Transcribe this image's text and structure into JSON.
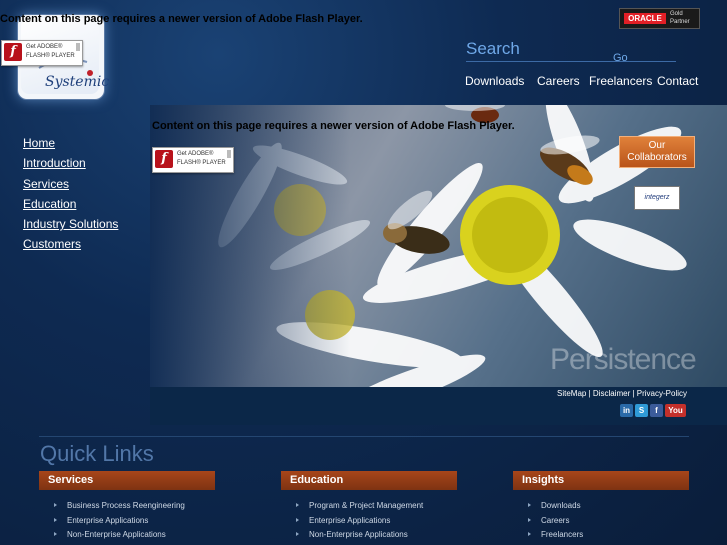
{
  "flash": {
    "message": "Content on this page requires a newer version of Adobe Flash Player.",
    "badge_line1": "Get ADOBE®",
    "badge_line2": "FLASH® PLAYER",
    "badge_icon": "f"
  },
  "logo": {
    "text": "Systemic"
  },
  "oracle": {
    "name": "ORACLE",
    "tier": "Gold",
    "partner": "Partner"
  },
  "search": {
    "label": "Search",
    "placeholder": "",
    "go": "Go"
  },
  "topnav": [
    "Downloads",
    "Careers",
    "Freelancers",
    "Contact"
  ],
  "leftnav": [
    "Home",
    "Introduction ",
    "Services",
    "Education",
    "Industry Solutions",
    "Customers"
  ],
  "hero": {
    "tagline": "Persistence",
    "collaborators_line1": "Our",
    "collaborators_line2": "Collaborators",
    "partner_logo": "integerz"
  },
  "footer": {
    "sitemap": "SiteMap",
    "sep": " | ",
    "disclaimer": "Disclaimer",
    "privacy": "Privacy-Policy"
  },
  "social": [
    {
      "icon": "linkedin-icon",
      "glyph": "in",
      "color": "#2a6aa8"
    },
    {
      "icon": "skype-icon",
      "glyph": "S",
      "color": "#2f9ad6"
    },
    {
      "icon": "facebook-icon",
      "glyph": "f",
      "color": "#3b5b9a"
    },
    {
      "icon": "youtube-icon",
      "glyph": "You",
      "color": "#c4302b"
    }
  ],
  "quick_links": {
    "title": "Quick  Links",
    "columns": [
      {
        "heading": "Services",
        "items": [
          "Business Process Reengineering",
          "Enterprise Applications",
          "Non-Enterprise Applications"
        ]
      },
      {
        "heading": "Education",
        "items": [
          "Program & Project Management",
          "Enterprise Applications",
          "Non-Enterprise Applications"
        ]
      },
      {
        "heading": "Insights",
        "items": [
          "Downloads",
          "Careers",
          "Freelancers"
        ]
      }
    ]
  },
  "colors": {
    "accent": "#6fa8e8",
    "quicklink_header": "#a7461a",
    "background": "#0e2a52"
  }
}
